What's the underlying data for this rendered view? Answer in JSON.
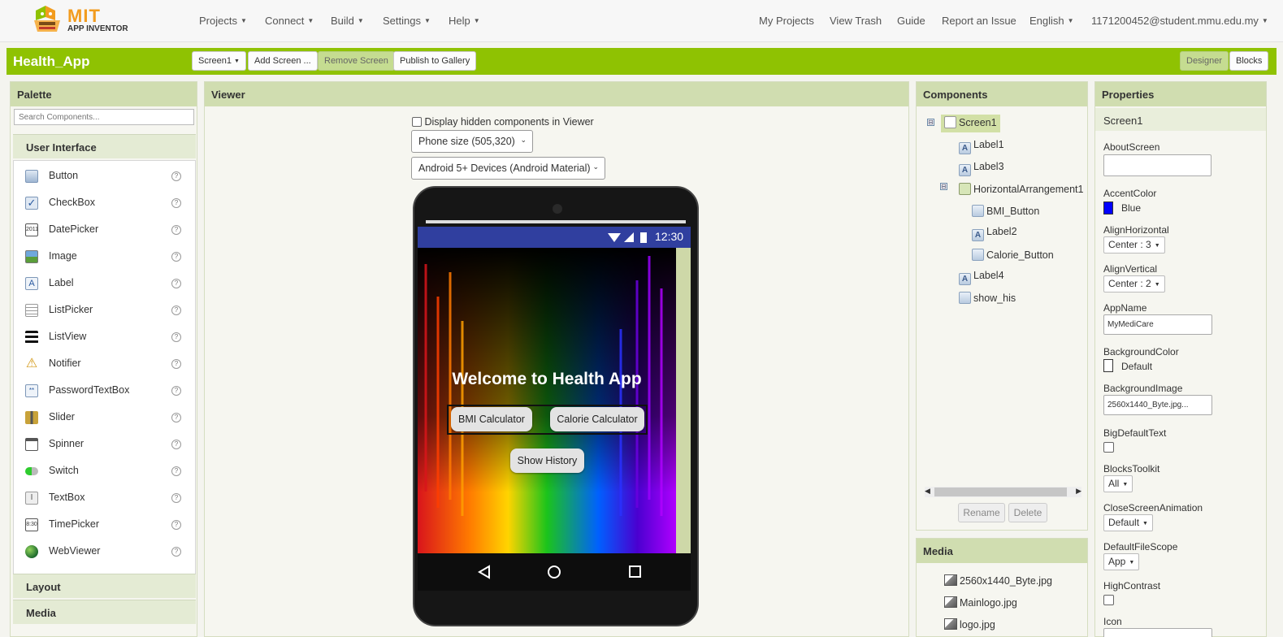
{
  "brand": {
    "mit": "MIT",
    "sub": "APP INVENTOR"
  },
  "nav": {
    "left": [
      "Projects",
      "Connect",
      "Build",
      "Settings",
      "Help"
    ],
    "right": [
      "My Projects",
      "View Trash",
      "Guide",
      "Report an Issue",
      "English",
      "1171200452@student.mmu.edu.my"
    ]
  },
  "project": {
    "name": "Health_App",
    "screen_select": "Screen1",
    "add_screen": "Add Screen ...",
    "remove_screen": "Remove Screen",
    "publish": "Publish to Gallery",
    "designer": "Designer",
    "blocks": "Blocks"
  },
  "palette": {
    "title": "Palette",
    "search_placeholder": "Search Components...",
    "category_ui": "User Interface",
    "items": [
      "Button",
      "CheckBox",
      "DatePicker",
      "Image",
      "Label",
      "ListPicker",
      "ListView",
      "Notifier",
      "PasswordTextBox",
      "Slider",
      "Spinner",
      "Switch",
      "TextBox",
      "TimePicker",
      "WebViewer"
    ],
    "help": "?",
    "category_layout": "Layout",
    "category_media": "Media"
  },
  "viewer": {
    "title": "Viewer",
    "hidden_label": "Display hidden components in Viewer",
    "phone_size": "Phone size (505,320)",
    "theme": "Android 5+ Devices (Android Material)",
    "time": "12:30",
    "welcome": "Welcome to Health App",
    "bmi_button": "BMI Calculator",
    "calorie_button": "Calorie Calculator",
    "history_button": "Show History"
  },
  "components": {
    "title": "Components",
    "tree": [
      "Screen1",
      "Label1",
      "Label3",
      "HorizontalArrangement1",
      "BMI_Button",
      "Label2",
      "Calorie_Button",
      "Label4",
      "show_his"
    ],
    "toggle": "⊟",
    "rename": "Rename",
    "delete": "Delete"
  },
  "media": {
    "title": "Media",
    "files": [
      "2560x1440_Byte.jpg",
      "Mainlogo.jpg",
      "logo.jpg"
    ]
  },
  "properties": {
    "title": "Properties",
    "component": "Screen1",
    "about_label": "AboutScreen",
    "accent_label": "AccentColor",
    "accent_value": "Blue",
    "accent_color": "#0000ff",
    "align_h_label": "AlignHorizontal",
    "align_h_value": "Center : 3",
    "align_v_label": "AlignVertical",
    "align_v_value": "Center : 2",
    "app_name_label": "AppName",
    "app_name_value": "MyMediCare",
    "bg_color_label": "BackgroundColor",
    "bg_color_value": "Default",
    "bg_image_label": "BackgroundImage",
    "bg_image_value": "2560x1440_Byte.jpg...",
    "big_text_label": "BigDefaultText",
    "toolkit_label": "BlocksToolkit",
    "toolkit_value": "All",
    "close_anim_label": "CloseScreenAnimation",
    "close_anim_value": "Default",
    "file_scope_label": "DefaultFileScope",
    "file_scope_value": "App",
    "contrast_label": "HighContrast",
    "icon_label": "Icon"
  },
  "colors": {
    "accent_green": "#8fc202",
    "panel_header": "#d0ddb0",
    "status_bar": "#303f9f"
  }
}
